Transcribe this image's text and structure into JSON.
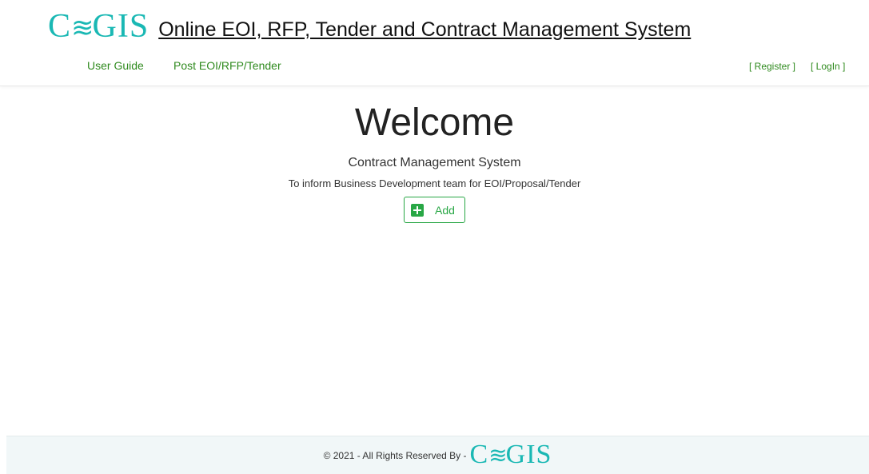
{
  "header": {
    "logo": {
      "c": "C",
      "wave": "≋",
      "gis": "GIS"
    },
    "title": "Online EOI, RFP, Tender and Contract Management System"
  },
  "nav": {
    "user_guide": "User Guide",
    "post": "Post EOI/RFP/Tender",
    "register": "[ Register ]",
    "login": "[ LogIn ]"
  },
  "main": {
    "welcome": "Welcome",
    "subtitle": "Contract Management System",
    "tagline": "To inform Business Development team for EOI/Proposal/Tender",
    "add_label": "Add"
  },
  "footer": {
    "text": "© 2021 - All Rights Reserved By -"
  },
  "colors": {
    "accent": "#28a745",
    "link": "#2f8a1e",
    "logo": "#1ab8b4"
  }
}
